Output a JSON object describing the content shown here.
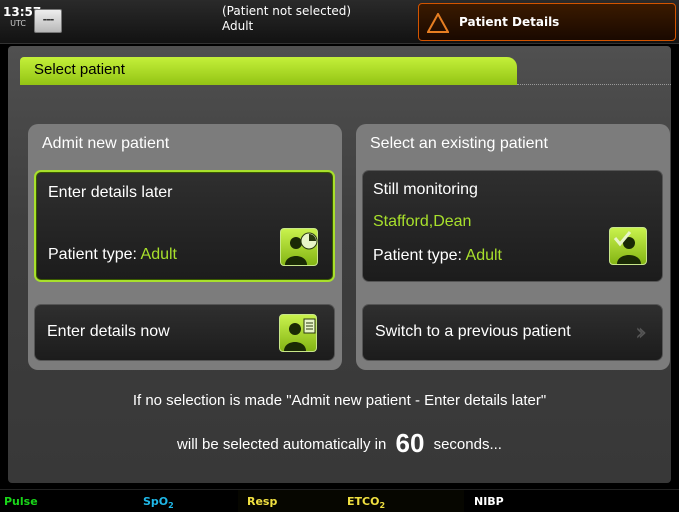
{
  "header": {
    "clock_time": "13:57",
    "clock_zone": "UTC",
    "dash_label": "---",
    "patient_status_line1": "(Patient not selected)",
    "patient_status_line2": "Adult",
    "details_button_label": "Patient Details"
  },
  "panel": {
    "title": "Select patient",
    "admit": {
      "heading": "Admit new patient",
      "later_card": {
        "title": "Enter details later",
        "type_label": "Patient type:",
        "type_value": "Adult"
      },
      "now_card": {
        "title": "Enter details now"
      }
    },
    "existing": {
      "heading": "Select an existing patient",
      "monitoring_card": {
        "title": "Still monitoring",
        "patient_name": "Stafford,Dean",
        "type_label": "Patient type:",
        "type_value": "Adult"
      },
      "previous_card": {
        "title": "Switch to a previous patient"
      }
    },
    "info_line1": "If no selection is made \"Admit new patient - Enter details later\"",
    "info_line2_pre": "will be selected automatically in",
    "countdown": "60",
    "info_line2_post": "seconds..."
  },
  "bottom_bar": {
    "pulse": "Pulse",
    "spo2": "SpO",
    "spo2_sub": "2",
    "resp": "Resp",
    "etco2": "ETCO",
    "etco2_sub": "2",
    "nibp": "NIBP"
  },
  "colors": {
    "pulse": "#19d619",
    "spo2": "#1fb8e8",
    "resp": "#f0e040",
    "etco2": "#f0e040",
    "nibp": "#ffffff",
    "accent_green": "#a8e02c",
    "warning_orange": "#d35400"
  },
  "icons": {
    "later": "patient-clock-icon",
    "now": "patient-form-icon",
    "monitoring": "patient-check-icon",
    "previous": "double-chevron-right-icon",
    "warning": "warning-triangle-icon"
  }
}
